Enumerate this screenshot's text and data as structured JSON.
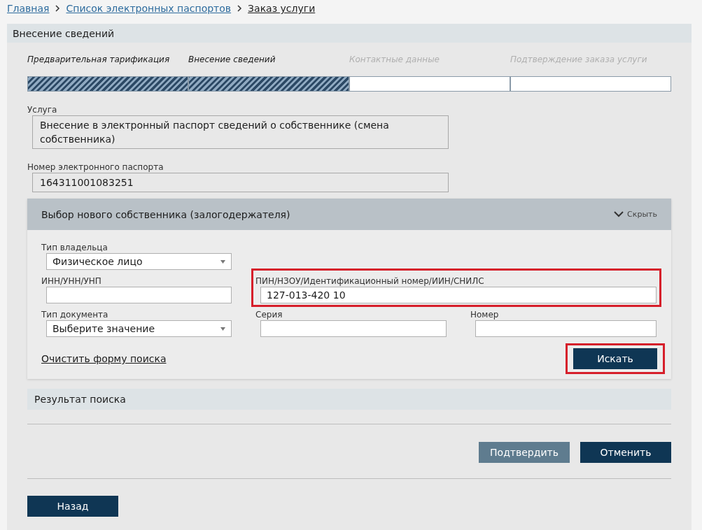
{
  "breadcrumbs": [
    {
      "label": "Главная",
      "current": false
    },
    {
      "label": "Список электронных паспортов",
      "current": false
    },
    {
      "label": "Заказ услуги",
      "current": true
    }
  ],
  "panel": {
    "title": "Внесение сведений"
  },
  "steps": [
    {
      "label": "Предварительная тарификация",
      "completed": true
    },
    {
      "label": "Внесение сведений",
      "completed": true
    },
    {
      "label": "Контактные данные",
      "completed": false
    },
    {
      "label": "Подтверждение заказа услуги",
      "completed": false
    }
  ],
  "service": {
    "label": "Услуга",
    "value": "Внесение в электронный паспорт сведений о собственнике (смена собственника)"
  },
  "passport": {
    "label": "Номер электронного паспорта",
    "value": "164311001083251"
  },
  "owner_search": {
    "title": "Выбор нового собственника (залогодержателя)",
    "toggle": "Скрыть",
    "rows": [
      [
        {
          "kind": "select",
          "label": "Тип владельца",
          "value": "Физическое лицо",
          "highlighted": false
        }
      ],
      [
        {
          "kind": "input",
          "label": "ИНН/УНН/УНП",
          "highlighted": false
        },
        {
          "kind": "input",
          "label": "ПИН/НЗОУ/Идентификационный номер/ИИН/СНИЛС",
          "value": "127-013-420 10",
          "highlighted": true
        }
      ],
      [
        {
          "kind": "select",
          "label": "Тип документа",
          "value": "Выберите значение",
          "highlighted": false
        },
        {
          "kind": "input",
          "label": "Серия",
          "highlighted": false
        },
        {
          "kind": "input",
          "label": "Номер",
          "highlighted": false
        }
      ]
    ],
    "clear_link": "Очистить форму поиска",
    "search_button": {
      "label": "Искать",
      "highlighted": true
    }
  },
  "results": {
    "title": "Результат поиска"
  },
  "buttons": [
    {
      "label": "Подтвердить",
      "disabled": true
    },
    {
      "label": "Отменить",
      "disabled": false
    }
  ],
  "back_button": "Назад"
}
